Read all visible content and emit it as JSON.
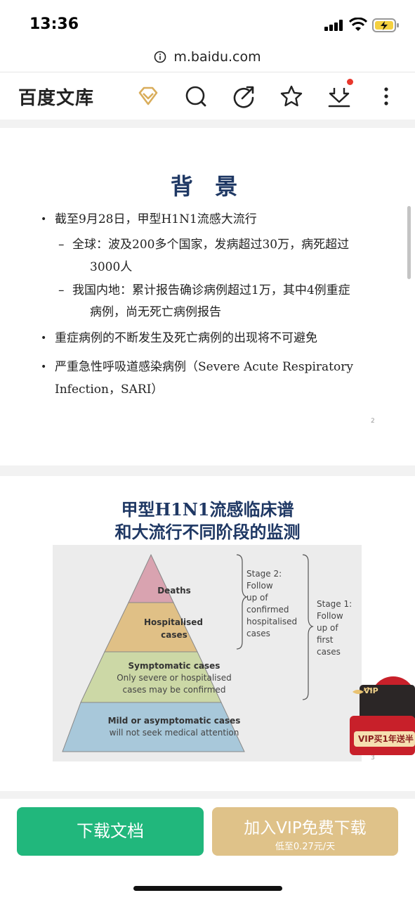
{
  "status_bar": {
    "time": "13:36"
  },
  "browser": {
    "url": "m.baidu.com"
  },
  "app": {
    "brand": "百度文库"
  },
  "slide1": {
    "title": "背 景",
    "bullets": [
      "截至9月28日，甲型H1N1流感大流行",
      "重症病例的不断发生及死亡病例的出现将不可避免",
      "严重急性呼吸道感染病例（Severe Acute Respiratory",
      "Infection，SARI）"
    ],
    "sub": [
      {
        "line1": "全球：波及200多个国家，发病超过30万，病死超过",
        "line2": "3000人"
      },
      {
        "line1": "我国内地：累计报告确诊病例超过1万，其中4例重症",
        "line2": "病例，尚无死亡病例报告"
      }
    ],
    "page": "2"
  },
  "slide2": {
    "title_line1": "甲型H1N1流感临床谱",
    "title_line2": "和大流行不同阶段的监测",
    "pyramid": {
      "tier1": "Deaths",
      "tier2a": "Hospitalised",
      "tier2b": "cases",
      "tier3a": "Symptomatic cases",
      "tier3b": "Only severe or hospitalised",
      "tier3c": "cases may be confirmed",
      "tier4a": "Mild or asymptomatic cases",
      "tier4b": "will not seek medical attention",
      "stage2": [
        "Stage 2:",
        "Follow",
        "up of",
        "confirmed",
        "hospitalised",
        "cases"
      ],
      "stage1": [
        "Stage 1:",
        "Follow",
        "up of",
        "first",
        "cases"
      ]
    },
    "page": "3"
  },
  "vip_float": {
    "card": "VIP",
    "label": "VIP买1年送半"
  },
  "bottom": {
    "download": "下载文档",
    "vip_main": "加入VIP免费下载",
    "vip_sub": "低至0.27元/天"
  },
  "colors": {
    "download_green": "#21b77c",
    "vip_gold": "#dfc289",
    "title_navy": "#1f3864",
    "tier_deaths": "#d9a3b0",
    "tier_hosp": "#e0c086",
    "tier_symp": "#ccd8a6",
    "tier_mild": "#a8c8da"
  }
}
